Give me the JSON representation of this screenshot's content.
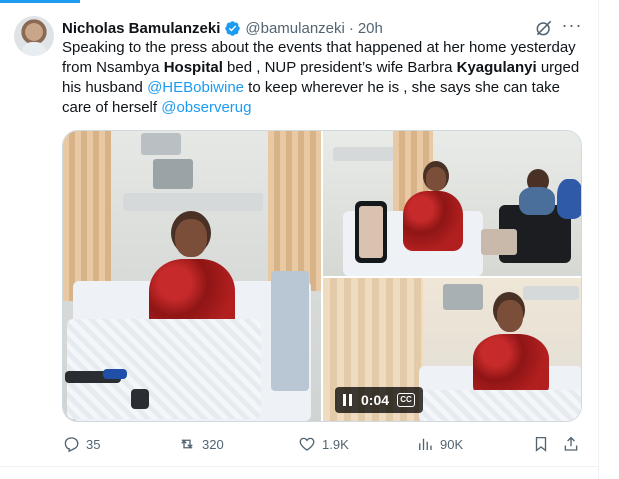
{
  "tweet": {
    "author_name": "Nicholas Bamulanzeki",
    "handle": "@bamulanzeki",
    "separator": "·",
    "time": "20h",
    "text": {
      "p1": "Speaking to the press about the events that happened at her home yesterday from Nsambya ",
      "b1": "Hospital",
      "p2": " bed   , NUP president’s wife Barbra ",
      "b2": "Kyagulanyi",
      "p3": " urged his husband ",
      "m1": "@HEBobiwine",
      "p4": " to keep wherever he is ,  she says she can take care of herself   ",
      "m2": "@observerug"
    }
  },
  "media": {
    "video_time": "0:04",
    "cc_label": "CC"
  },
  "actions": {
    "replies": "35",
    "reposts": "320",
    "likes": "1.9K",
    "views": "90K"
  },
  "colors": {
    "accent": "#1d9bf0",
    "muted": "#536471",
    "text": "#0f1419"
  },
  "icons": [
    "verified-badge-icon",
    "grok-icon",
    "more-icon",
    "reply-icon",
    "repost-icon",
    "like-icon",
    "views-icon",
    "bookmark-icon",
    "share-icon",
    "pause-icon",
    "cc-icon"
  ]
}
